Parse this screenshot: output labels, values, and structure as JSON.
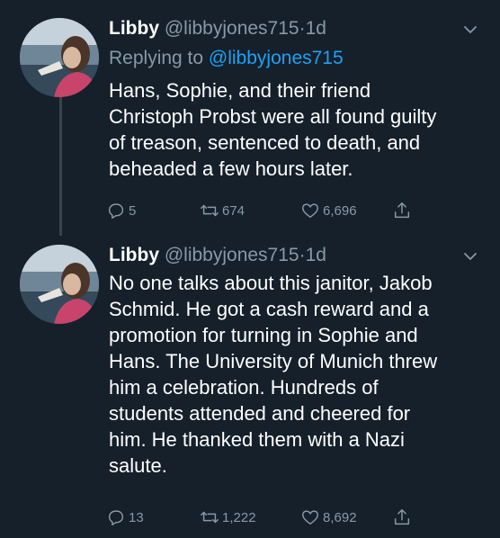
{
  "colors": {
    "background": "#15202b",
    "text_primary": "#ffffff",
    "text_secondary": "#8899a6",
    "link": "#1da1f2",
    "thread_line": "#38444d"
  },
  "tweets": [
    {
      "author_name": "Libby",
      "handle": "@libbyjones715",
      "separator": "·",
      "time": "1d",
      "replying_to_prefix": "Replying to ",
      "replying_to_handle": "@libbyjones715",
      "text": "Hans, Sophie, and their friend\nChristoph Probst were all found guilty\nof treason, sentenced to death, and\nbeheaded a few hours later.",
      "replies": "5",
      "retweets": "674",
      "likes": "6,696",
      "icons": {
        "reply": "reply-icon",
        "retweet": "retweet-icon",
        "like": "heart-icon",
        "share": "share-icon",
        "menu": "chevron-down-icon"
      }
    },
    {
      "author_name": "Libby",
      "handle": "@libbyjones715",
      "separator": "·",
      "time": "1d",
      "text": "No one talks about this janitor, Jakob\nSchmid. He got a cash reward and a\npromotion for turning in Sophie and\nHans. The University of Munich threw\nhim a celebration. Hundreds of\nstudents attended and cheered for\nhim. He thanked them with a Nazi\nsalute.",
      "replies": "13",
      "retweets": "1,222",
      "likes": "8,692",
      "icons": {
        "reply": "reply-icon",
        "retweet": "retweet-icon",
        "like": "heart-icon",
        "share": "share-icon",
        "menu": "chevron-down-icon"
      }
    }
  ]
}
